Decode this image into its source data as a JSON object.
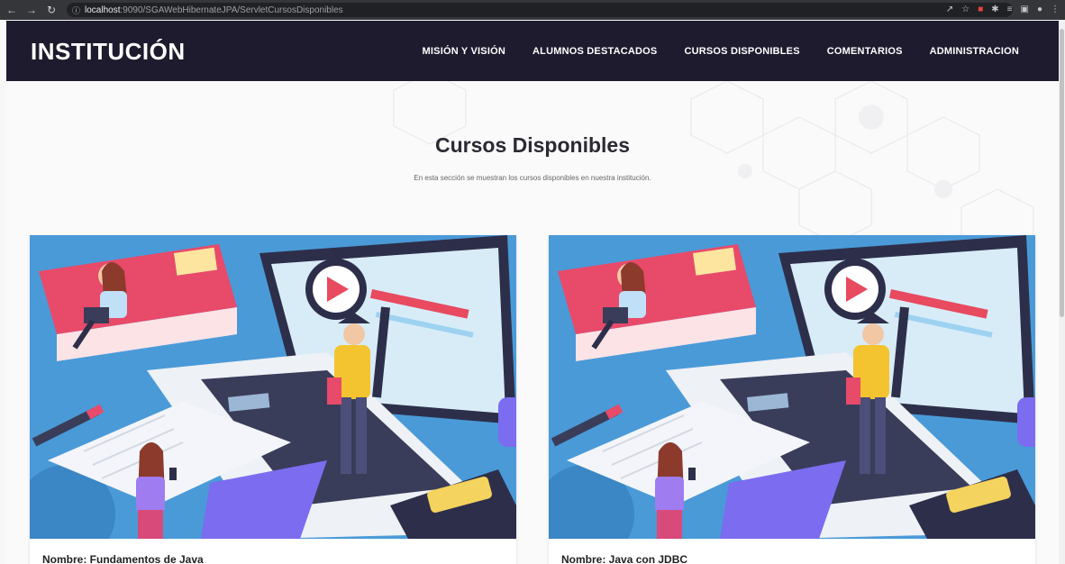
{
  "browser": {
    "url_host": "localhost",
    "url_rest": ":9090/SGAWebHibernateJPA/ServletCursosDisponibles"
  },
  "header": {
    "brand": "INSTITUCIÓN",
    "menu": [
      {
        "label": "MISIÓN Y VISIÓN"
      },
      {
        "label": "ALUMNOS DESTACADOS"
      },
      {
        "label": "CURSOS DISPONIBLES"
      },
      {
        "label": "COMENTARIOS"
      },
      {
        "label": "ADMINISTRACION"
      }
    ],
    "bg_color": "#1e1b2e"
  },
  "section": {
    "title": "Cursos Disponibles",
    "subtitle": "En esta sección se muestran los cursos disponibles en nuestra institución."
  },
  "courses": [
    {
      "name": "Nombre: Fundamentos de Java"
    },
    {
      "name": "Nombre: Java con JDBC"
    }
  ]
}
